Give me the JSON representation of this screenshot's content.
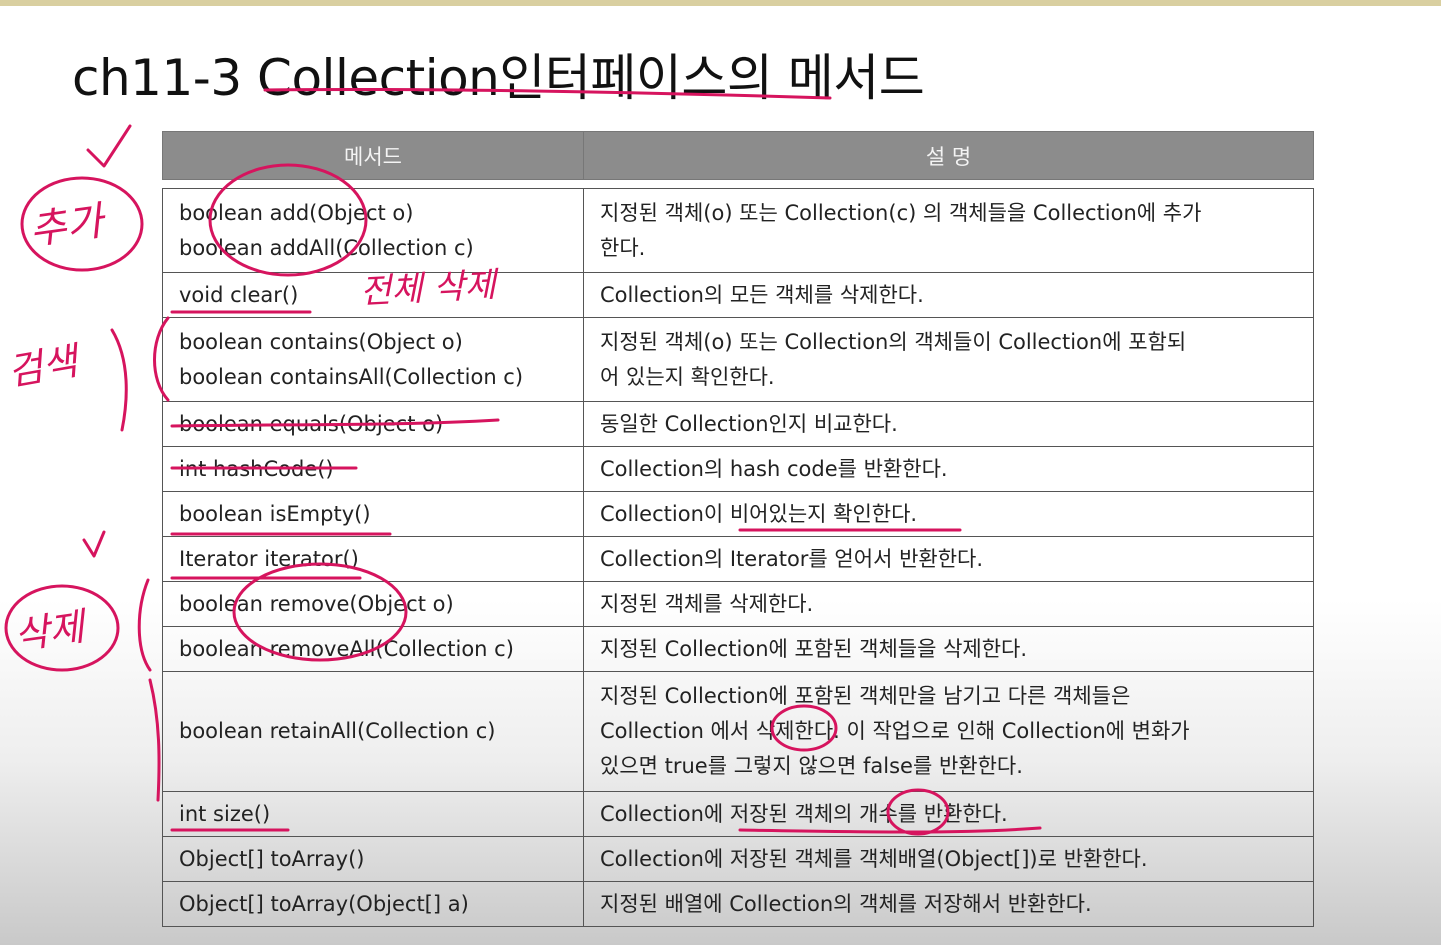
{
  "slide": {
    "title": "ch11-3 Collection인터페이스의 메서드"
  },
  "table": {
    "headers": [
      "메서드",
      "설 명"
    ],
    "rows": [
      {
        "method": [
          "boolean add(Object o)",
          "boolean addAll(Collection c)"
        ],
        "desc": [
          "지정된 객체(o) 또는 Collection(c) 의 객체들을 Collection에 추가",
          "한다."
        ]
      },
      {
        "method": [
          "void clear()"
        ],
        "desc": [
          "Collection의 모든 객체를 삭제한다."
        ]
      },
      {
        "method": [
          "boolean contains(Object o)",
          "boolean containsAll(Collection c)"
        ],
        "desc": [
          "지정된 객체(o) 또는 Collection의 객체들이 Collection에 포함되",
          "어 있는지 확인한다."
        ]
      },
      {
        "method": [
          "boolean equals(Object o)"
        ],
        "desc": [
          "동일한 Collection인지 비교한다."
        ]
      },
      {
        "method": [
          "int hashCode()"
        ],
        "desc": [
          "Collection의 hash code를 반환한다."
        ]
      },
      {
        "method": [
          "boolean isEmpty()"
        ],
        "desc": [
          "Collection이 비어있는지 확인한다."
        ]
      },
      {
        "method": [
          "Iterator iterator()"
        ],
        "desc": [
          "Collection의 Iterator를 얻어서 반환한다."
        ]
      },
      {
        "method": [
          "boolean remove(Object o)"
        ],
        "desc": [
          "지정된 객체를 삭제한다."
        ]
      },
      {
        "method": [
          "boolean removeAll(Collection c)"
        ],
        "desc": [
          "지정된 Collection에 포함된 객체들을 삭제한다."
        ]
      },
      {
        "method": [
          "boolean retainAll(Collection c)"
        ],
        "desc": [
          "지정된 Collection에 포함된 객체만을 남기고 다른 객체들은",
          "Collection 에서 삭제한다. 이 작업으로 인해 Collection에 변화가",
          "있으면 true를 그렇지 않으면 false를 반환한다."
        ]
      },
      {
        "method": [
          "int size()"
        ],
        "desc": [
          "Collection에 저장된 객체의 개수를 반환한다."
        ]
      },
      {
        "method": [
          "Object[] toArray()"
        ],
        "desc": [
          "Collection에 저장된 객체를 객체배열(Object[])로 반환한다."
        ]
      },
      {
        "method": [
          "Object[] toArray(Object[] a)"
        ],
        "desc": [
          "지정된 배열에 Collection의 객체를 저장해서 반환한다."
        ]
      }
    ]
  },
  "handwriting": {
    "color": "#d6145e",
    "notes": [
      "추가",
      "전체 삭제",
      "검색",
      "삭제"
    ]
  }
}
